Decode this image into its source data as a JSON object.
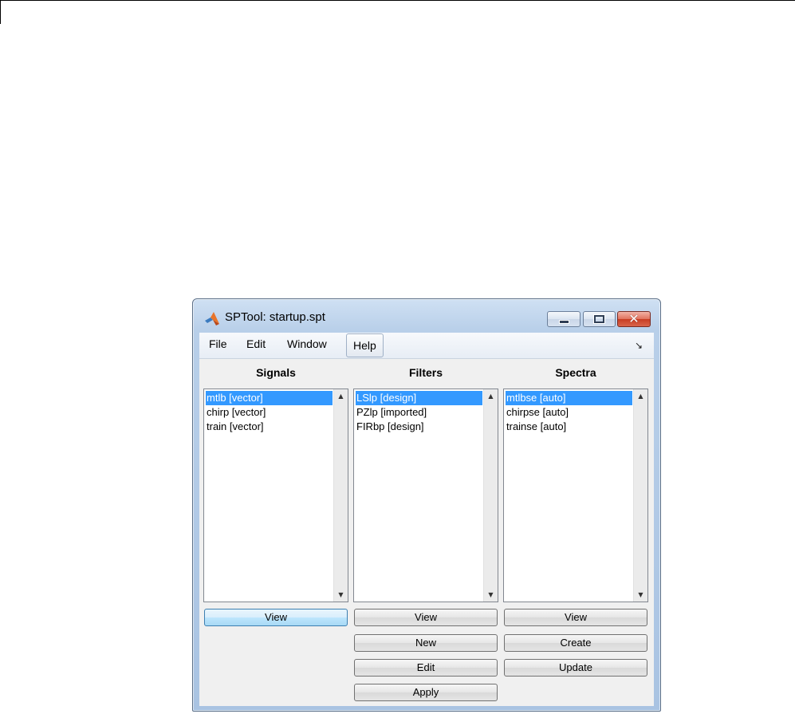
{
  "window": {
    "title": "SPTool: startup.spt",
    "controls": {
      "minimize": "–",
      "maximize": "□",
      "close": "✕"
    }
  },
  "menu": {
    "items": [
      "File",
      "Edit",
      "Window",
      "Help"
    ],
    "dock_icon": "↘"
  },
  "columns": {
    "signals": {
      "header": "Signals",
      "items": [
        "mtlb [vector]",
        "chirp [vector]",
        "train [vector]"
      ],
      "selected_index": 0,
      "buttons": [
        "View"
      ]
    },
    "filters": {
      "header": "Filters",
      "items": [
        "LSlp [design]",
        "PZlp [imported]",
        "FIRbp [design]"
      ],
      "selected_index": 0,
      "buttons": [
        "View",
        "New",
        "Edit",
        "Apply"
      ]
    },
    "spectra": {
      "header": "Spectra",
      "items": [
        "mtlbse [auto]",
        "chirpse [auto]",
        "trainse [auto]"
      ],
      "selected_index": 0,
      "buttons": [
        "View",
        "Create",
        "Update"
      ]
    }
  },
  "scroll": {
    "up": "▲",
    "down": "▼"
  },
  "colors": {
    "selection": "#3399ff",
    "focused_button": "#bee6fd",
    "client_bg": "#f0f0f0"
  },
  "icons": {
    "app": "matlab-membrane-icon",
    "dock": "dock-arrow-icon"
  }
}
